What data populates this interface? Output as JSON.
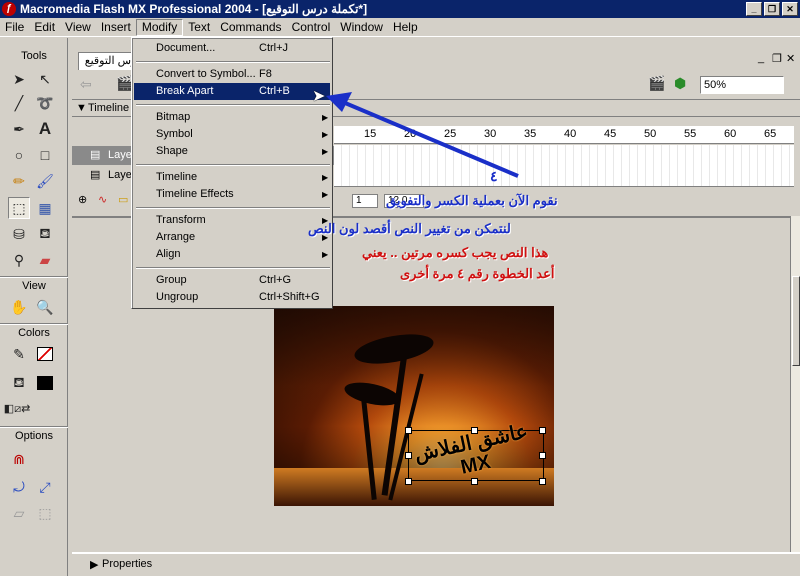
{
  "window": {
    "title": "Macromedia Flash MX Professional 2004 - [تكملة درس التوقيع*]",
    "buttons": [
      "_",
      "❐",
      "✕"
    ]
  },
  "menubar": {
    "items": [
      "File",
      "Edit",
      "View",
      "Insert",
      "Modify",
      "Text",
      "Commands",
      "Control",
      "Window",
      "Help"
    ],
    "active": "Modify"
  },
  "tools": {
    "header": "Tools",
    "view_header": "View",
    "colors_header": "Colors",
    "options_header": "Options"
  },
  "document": {
    "tab_label": "درس التوقيع",
    "zoom": "50%",
    "timeline_label": "Timeline",
    "layers": [
      "Layer",
      "Layer"
    ],
    "ruler_ticks": [
      "15",
      "20",
      "25",
      "30",
      "35",
      "40",
      "45",
      "50",
      "55",
      "60",
      "65"
    ],
    "frame_number": "1",
    "fps": "12.0",
    "properties_label": "Properties"
  },
  "modify_menu": {
    "groups": [
      [
        {
          "label": "Document...",
          "shortcut": "Ctrl+J"
        }
      ],
      [
        {
          "label": "Convert to Symbol...",
          "shortcut": "F8"
        },
        {
          "label": "Break Apart",
          "shortcut": "Ctrl+B",
          "highlighted": true
        }
      ],
      [
        {
          "label": "Bitmap",
          "submenu": true
        },
        {
          "label": "Symbol",
          "submenu": true
        },
        {
          "label": "Shape",
          "submenu": true
        }
      ],
      [
        {
          "label": "Timeline",
          "submenu": true
        },
        {
          "label": "Timeline Effects",
          "submenu": true
        }
      ],
      [
        {
          "label": "Transform",
          "submenu": true
        },
        {
          "label": "Arrange",
          "submenu": true
        },
        {
          "label": "Align",
          "submenu": true
        }
      ],
      [
        {
          "label": "Group",
          "shortcut": "Ctrl+G"
        },
        {
          "label": "Ungroup",
          "shortcut": "Ctrl+Shift+G"
        }
      ]
    ]
  },
  "stage": {
    "text_object": "عاشق الفلاش MX"
  },
  "annotations": {
    "step_number": "٤",
    "line1": "نقوم الآن بعملية الكسر والتفويق",
    "line2": "لنتمكن من تغيير النص أقصد لون النص",
    "line3": "هذا النص يجب كسره مرتين .. يعني",
    "line4": "أعد الخطوة رقم ٤ مرة أخرى",
    "colors": {
      "blue": "#1a2fc8",
      "red": "#d01010"
    }
  }
}
